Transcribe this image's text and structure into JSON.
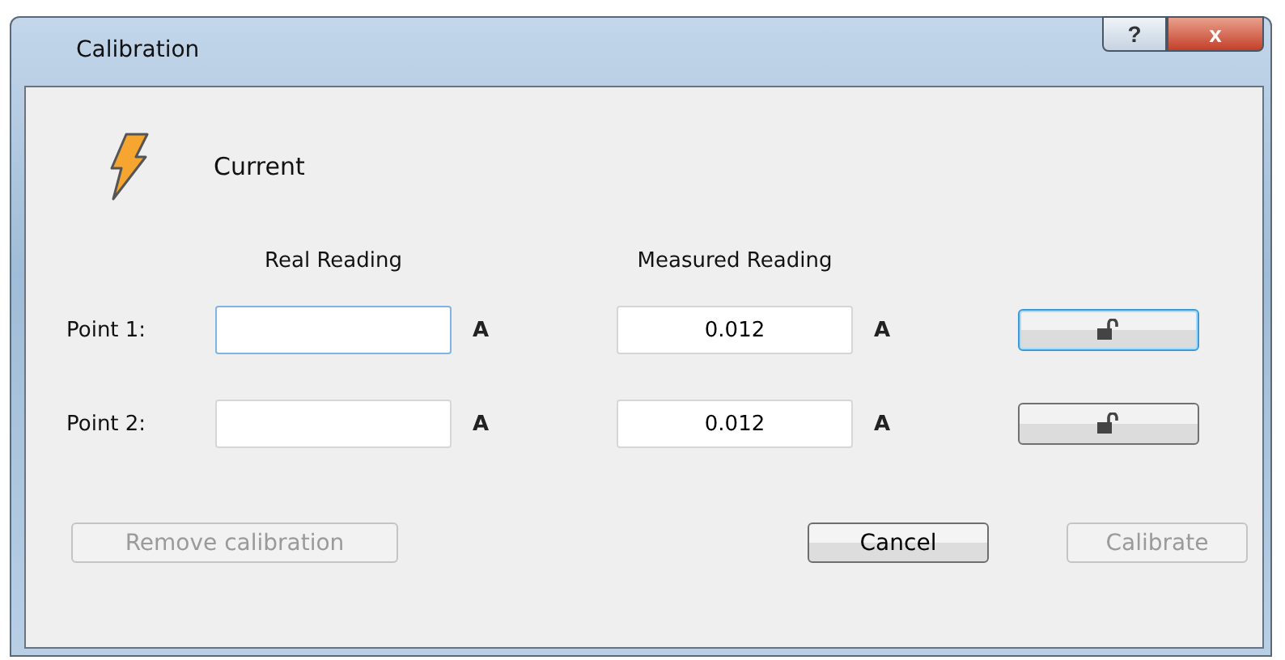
{
  "window": {
    "title": "Calibration",
    "help_button": "?",
    "close_button": "x"
  },
  "header": {
    "label": "Current"
  },
  "columns": [
    "Real Reading",
    "Measured Reading"
  ],
  "points": [
    {
      "label": "Point 1:",
      "real_unit": "A",
      "measured_value": "0.012",
      "measured_unit": "A",
      "focused": true,
      "locked": false
    },
    {
      "label": "Point 2:",
      "real_unit": "A",
      "measured_value": "0.012",
      "measured_unit": "A",
      "focused": false,
      "locked": false
    }
  ],
  "buttons": [
    {
      "label": "Remove calibration",
      "disabled": true
    },
    {
      "label": "Cancel",
      "disabled": false
    },
    {
      "label": "Calibrate",
      "disabled": true
    }
  ]
}
